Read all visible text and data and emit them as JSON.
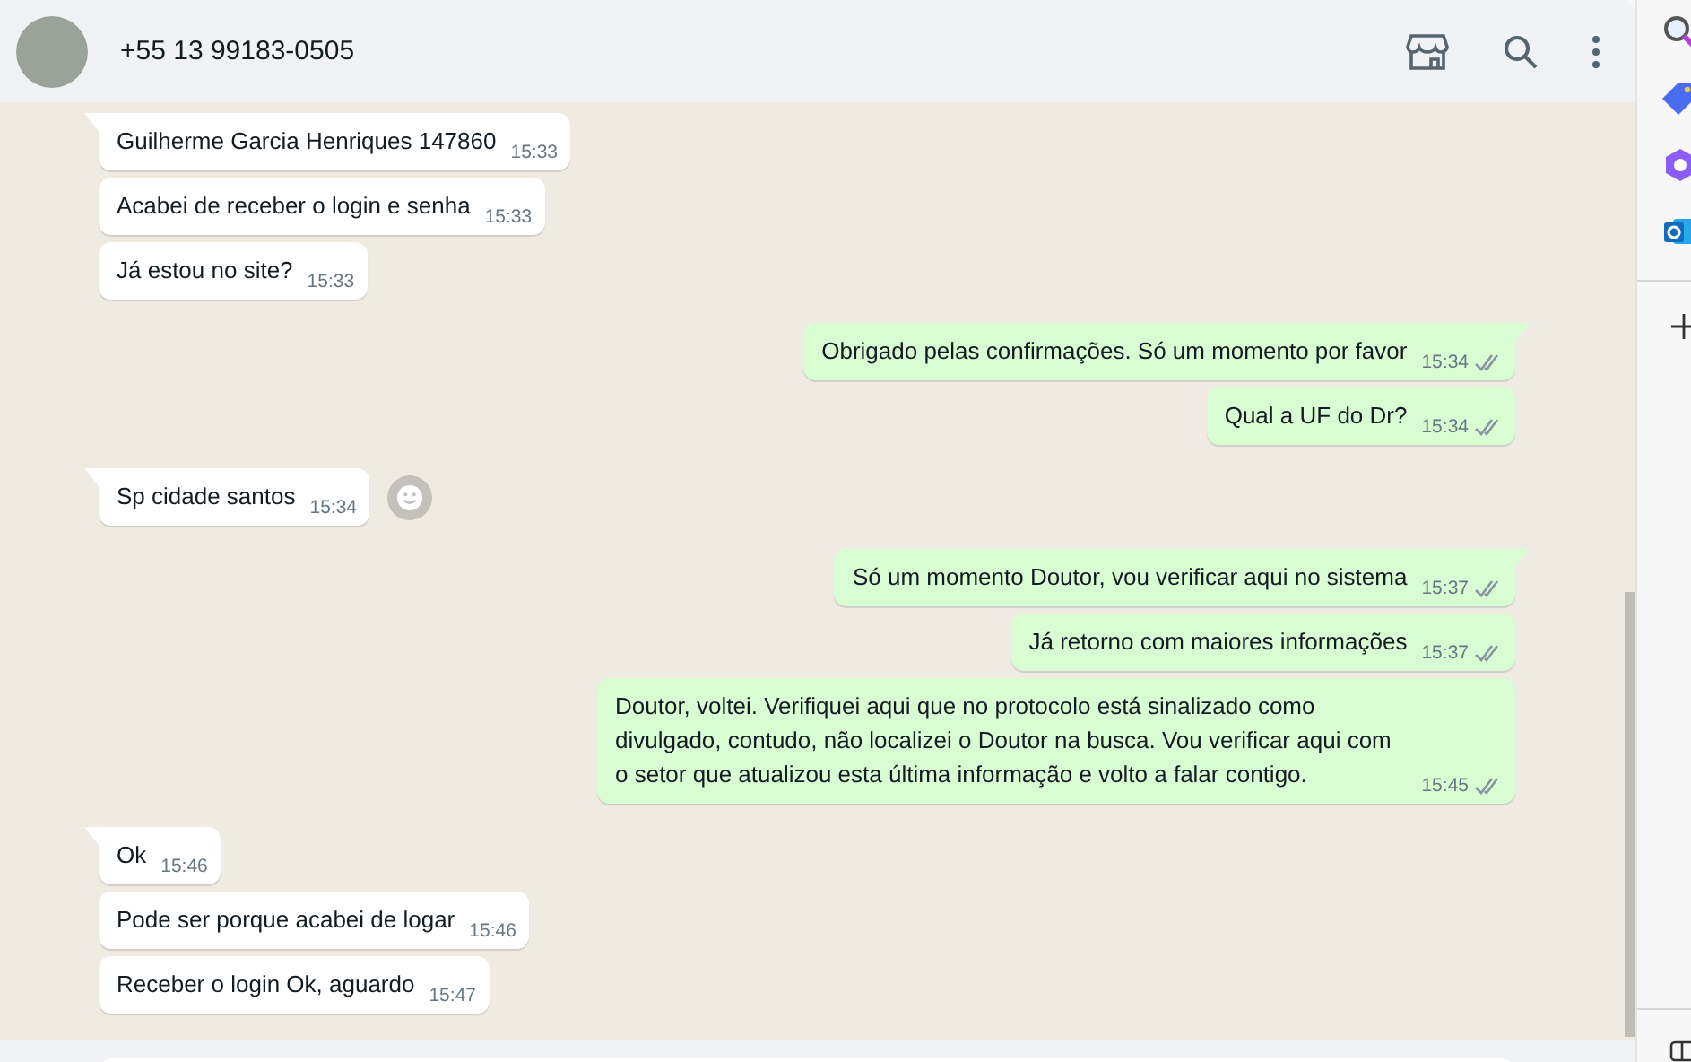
{
  "header": {
    "contact": "+55 13 99183-0505"
  },
  "messages": [
    {
      "outgoing": false,
      "text": "Guilherme Garcia Henriques 147860",
      "time": "15:33",
      "tail": true,
      "reaction_button": false
    },
    {
      "outgoing": false,
      "text": "Acabei de receber o login e senha",
      "time": "15:33",
      "tail": false,
      "reaction_button": false
    },
    {
      "outgoing": false,
      "text": "Já estou no site?",
      "time": "15:33",
      "tail": false,
      "reaction_button": false
    },
    {
      "outgoing": true,
      "text": "Obrigado pelas confirmações. Só um momento por favor",
      "time": "15:34",
      "tail": true,
      "read": false
    },
    {
      "outgoing": true,
      "text": "Qual a UF do Dr?",
      "time": "15:34",
      "tail": false,
      "read": false
    },
    {
      "outgoing": false,
      "text": "Sp cidade santos",
      "time": "15:34",
      "tail": true,
      "reaction_button": true
    },
    {
      "outgoing": true,
      "text": "Só um momento Doutor, vou verificar aqui no sistema",
      "time": "15:37",
      "tail": true,
      "read": false
    },
    {
      "outgoing": true,
      "text": "Já retorno com maiores informações",
      "time": "15:37",
      "tail": false,
      "read": false
    },
    {
      "outgoing": true,
      "text": "Doutor, voltei. Verifiquei aqui que no protocolo está sinalizado como divulgado, contudo, não localizei o Doutor na busca. Vou verificar aqui com o setor que atualizou esta última informação e volto a falar contigo.",
      "time": "15:45",
      "tail": false,
      "read": false
    },
    {
      "outgoing": false,
      "text": "Ok",
      "time": "15:46",
      "tail": true,
      "reaction_button": false
    },
    {
      "outgoing": false,
      "text": "Pode ser porque acabei de logar",
      "time": "15:46",
      "tail": false,
      "reaction_button": false
    },
    {
      "outgoing": false,
      "text": "Receber o login Ok, aguardo",
      "time": "15:47",
      "tail": false,
      "reaction_button": false
    }
  ]
}
